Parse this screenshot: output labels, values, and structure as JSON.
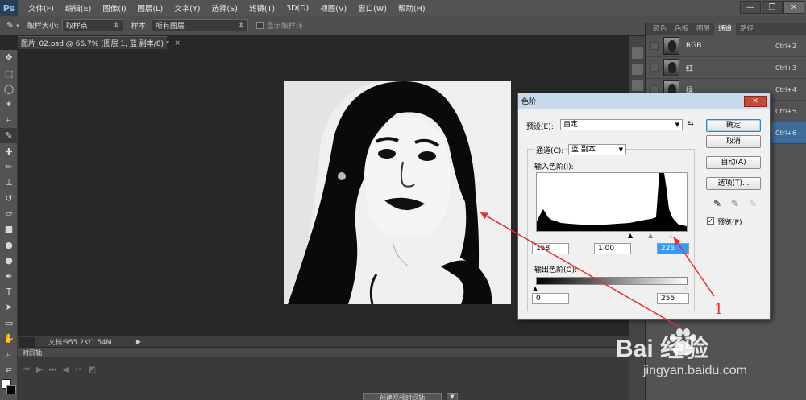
{
  "app": {
    "logo": "Ps",
    "menu": [
      "文件(F)",
      "编辑(E)",
      "图像(I)",
      "图层(L)",
      "文字(Y)",
      "选择(S)",
      "滤镜(T)",
      "3D(D)",
      "视图(V)",
      "窗口(W)",
      "帮助(H)"
    ],
    "window_controls": [
      "—",
      "❐",
      "✕"
    ]
  },
  "options": {
    "sample_size_label": "取样大小:",
    "sample_size_value": "取样点",
    "sample_label": "样本:",
    "sample_value": "所有图层",
    "show_ring_label": "显示取样环"
  },
  "document": {
    "tab_title": "图片_02.psd @ 66.7% (图层 1, 蓝 副本/8) *",
    "status": "文档:955.2K/1.54M"
  },
  "timeline": {
    "tab_label": "时间轴",
    "create_button": "创建视频时间轴"
  },
  "channels_panel": {
    "tabs": [
      "颜色",
      "色板",
      "图层",
      "通道",
      "路径"
    ],
    "active_tab": "通道",
    "channels": [
      {
        "name": "RGB",
        "shortcut": "Ctrl+2"
      },
      {
        "name": "红",
        "shortcut": "Ctrl+3"
      },
      {
        "name": "绿",
        "shortcut": "Ctrl+4"
      },
      {
        "name": "",
        "shortcut": "Ctrl+5"
      },
      {
        "name": "",
        "shortcut": "Ctrl+6"
      }
    ]
  },
  "levels_dialog": {
    "title": "色阶",
    "preset_label": "预设(E):",
    "preset_value": "自定",
    "channel_label": "通道(C):",
    "channel_value": "蓝 副本",
    "input_levels_label": "输入色阶(I):",
    "input_black": "158",
    "input_gamma": "1.00",
    "input_white": "225",
    "output_levels_label": "输出色阶(O):",
    "output_black": "0",
    "output_white": "255",
    "buttons": {
      "ok": "确定",
      "cancel": "取消",
      "auto": "自动(A)",
      "options": "选项(T)..."
    },
    "preview_label": "预览(P)",
    "preview_checked": true
  },
  "annotation": {
    "number": "1",
    "arrow_color": "#e03030"
  },
  "watermark": {
    "brand": "Bai 经验",
    "url": "jingyan.baidu.com"
  },
  "colors": {
    "accent_selected": "#3c6c9a",
    "dialog_title": "#c9d9ec",
    "close_button": "#c7493a"
  }
}
